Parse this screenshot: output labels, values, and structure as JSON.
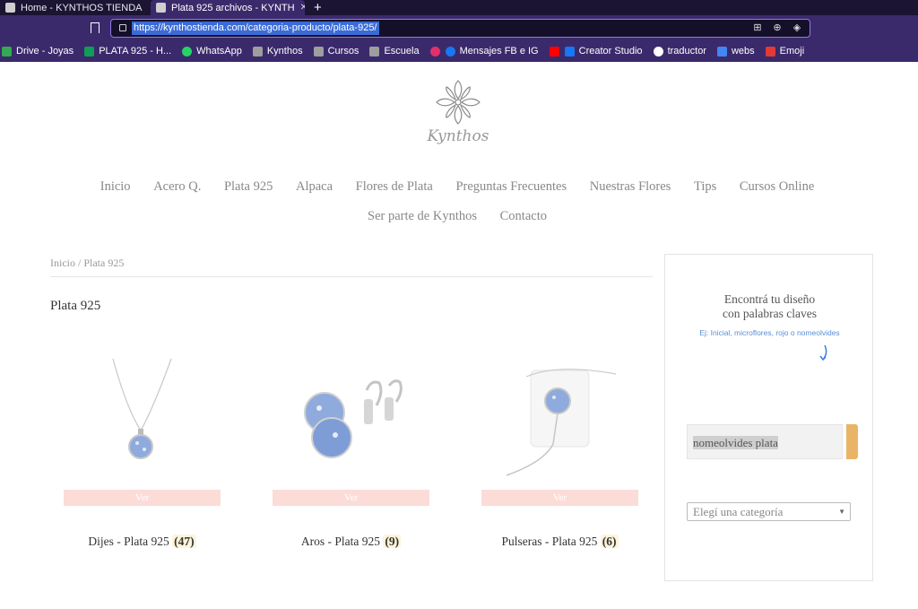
{
  "browser": {
    "tabs": [
      {
        "title": "Home - KYNTHOS TIENDA"
      },
      {
        "title": "Plata 925 archivos - KYNTH"
      }
    ],
    "new_tab_label": "+",
    "url": "https://kynthostienda.com/categoria-producto/plata-925/",
    "bookmarks": [
      {
        "label": "Drive - Joyas",
        "color": "#34a853"
      },
      {
        "label": "PLATA 925 - H...",
        "color": "#0f9d58"
      },
      {
        "label": "WhatsApp",
        "color": "#25d366"
      },
      {
        "label": "Kynthos",
        "color": "#9e9e9e"
      },
      {
        "label": "Cursos",
        "color": "#9e9e9e"
      },
      {
        "label": "Escuela",
        "color": "#9e9e9e"
      },
      {
        "label": "",
        "color": "#e1306c"
      },
      {
        "label": "Mensajes FB e IG",
        "color": "#1877f2"
      },
      {
        "label": "",
        "color": "#ff0000"
      },
      {
        "label": "Creator Studio",
        "color": "#1877f2"
      },
      {
        "label": "traductor",
        "color": "#ffffff"
      },
      {
        "label": "webs",
        "color": "#4285f4"
      },
      {
        "label": "Emoji",
        "color": "#e53935"
      }
    ]
  },
  "site": {
    "logo_text": "Kynthos",
    "menu": [
      "Inicio",
      "Acero Q.",
      "Plata 925",
      "Alpaca",
      "Flores de Plata",
      "Preguntas Frecuentes",
      "Nuestras Flores",
      "Tips",
      "Cursos Online"
    ],
    "menu_row2": [
      "Ser parte de Kynthos",
      "Contacto"
    ],
    "breadcrumb": "Inicio / Plata 925",
    "page_title": "Plata 925",
    "products": [
      {
        "name": "Dijes - Plata 925",
        "count": "(47)",
        "button": "Ver"
      },
      {
        "name": "Aros - Plata 925",
        "count": "(9)",
        "button": "Ver"
      },
      {
        "name": "Pulseras - Plata 925",
        "count": "(6)",
        "button": "Ver"
      }
    ],
    "sidebar": {
      "title_line1": "Encontrá tu diseño",
      "title_line2": "con palabras claves",
      "hint": "Ej: Inicial, microflores, rojo o nomeolvides",
      "search_value": "nomeolvides plata",
      "category_placeholder": "Elegí una categoría"
    }
  }
}
